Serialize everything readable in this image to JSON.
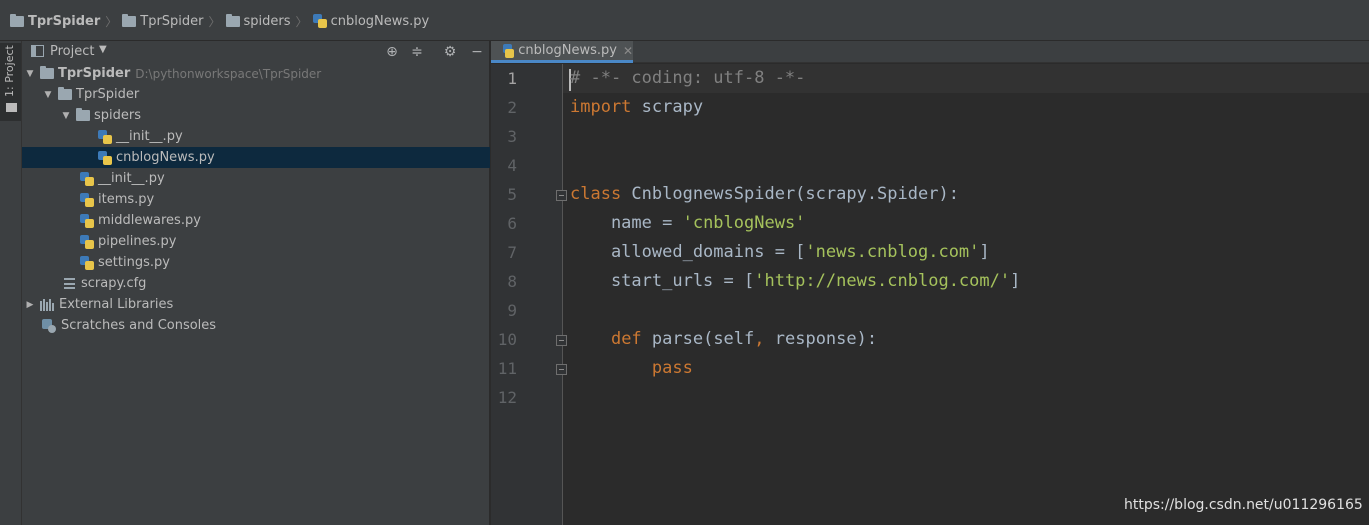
{
  "breadcrumb": [
    "TprSpider",
    "TprSpider",
    "spiders",
    "cnblogNews.py"
  ],
  "toolwindow": {
    "label": "1: Project"
  },
  "project_panel": {
    "title": "Project",
    "tree": [
      {
        "label": "TprSpider",
        "path": "D:\\pythonworkspace\\TprSpider",
        "arrow": "▼"
      },
      {
        "label": "TprSpider",
        "arrow": "▼"
      },
      {
        "label": "spiders",
        "arrow": "▼"
      },
      {
        "label": "__init__.py"
      },
      {
        "label": "cnblogNews.py",
        "selected": true
      },
      {
        "label": "__init__.py"
      },
      {
        "label": "items.py"
      },
      {
        "label": "middlewares.py"
      },
      {
        "label": "pipelines.py"
      },
      {
        "label": "settings.py"
      },
      {
        "label": "scrapy.cfg"
      },
      {
        "label": "External Libraries",
        "arrow": "▶"
      },
      {
        "label": "Scratches and Consoles"
      }
    ]
  },
  "editor": {
    "tab_label": "cnblogNews.py",
    "line_numbers": [
      "1",
      "2",
      "3",
      "4",
      "5",
      "6",
      "7",
      "8",
      "9",
      "10",
      "11",
      "12"
    ],
    "lines": [
      "# -*- coding: utf-8 -*-",
      "import scrapy",
      "",
      "",
      "class CnblognewsSpider(scrapy.Spider):",
      "    name = 'cnblogNews'",
      "    allowed_domains = ['news.cnblog.com']",
      "    start_urls = ['http://news.cnblog.com/']",
      "",
      "    def parse(self, response):",
      "        pass",
      ""
    ]
  },
  "watermark": "https://blog.csdn.net/u011296165"
}
